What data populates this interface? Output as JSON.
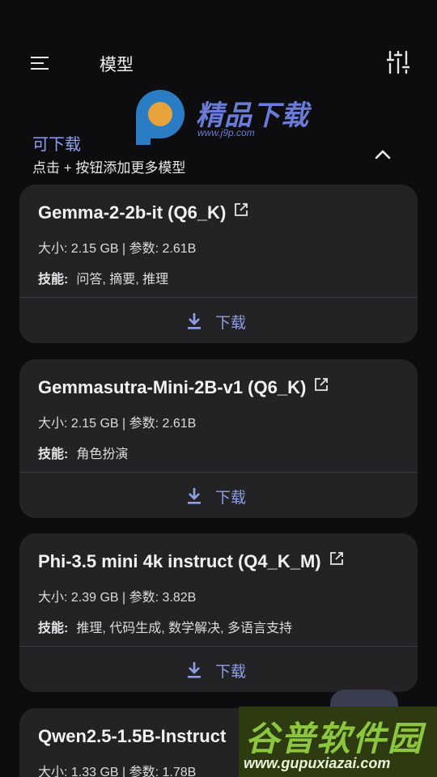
{
  "app_bar": {
    "title": "模型",
    "menu_icon": "menu-icon",
    "settings_icon": "tune-icon"
  },
  "watermark_top": {
    "title": "精品下载",
    "url": "www.j9p.com"
  },
  "section": {
    "title": "可下载",
    "subtitle": "点击 + 按钮添加更多模型",
    "toggle_icon": "chevron-up-icon"
  },
  "models": [
    {
      "name": "Gemma-2-2b-it (Q6_K)",
      "meta": "大小: 2.15 GB | 参数: 2.61B",
      "skills_label": "技能:",
      "skills": "问答, 摘要, 推理",
      "download_label": "下载"
    },
    {
      "name": "Gemmasutra-Mini-2B-v1 (Q6_K)",
      "meta": "大小: 2.15 GB | 参数: 2.61B",
      "skills_label": "技能:",
      "skills": "角色扮演",
      "download_label": "下载"
    },
    {
      "name": "Phi-3.5 mini 4k instruct (Q4_K_M)",
      "meta": "大小: 2.39 GB | 参数: 3.82B",
      "skills_label": "技能:",
      "skills": "推理, 代码生成, 数学解决, 多语言支持",
      "download_label": "下载"
    },
    {
      "name": "Qwen2.5-1.5B-Instruct",
      "meta": "大小: 1.33 GB | 参数: 1.78B"
    }
  ],
  "watermark_bottom": {
    "title": "谷普软件园",
    "url": "www.gupuxiazai.com"
  },
  "colors": {
    "background": "#0d0d0f",
    "card": "#232326",
    "accent": "#8fa0e8",
    "text": "#e6e6e6"
  }
}
